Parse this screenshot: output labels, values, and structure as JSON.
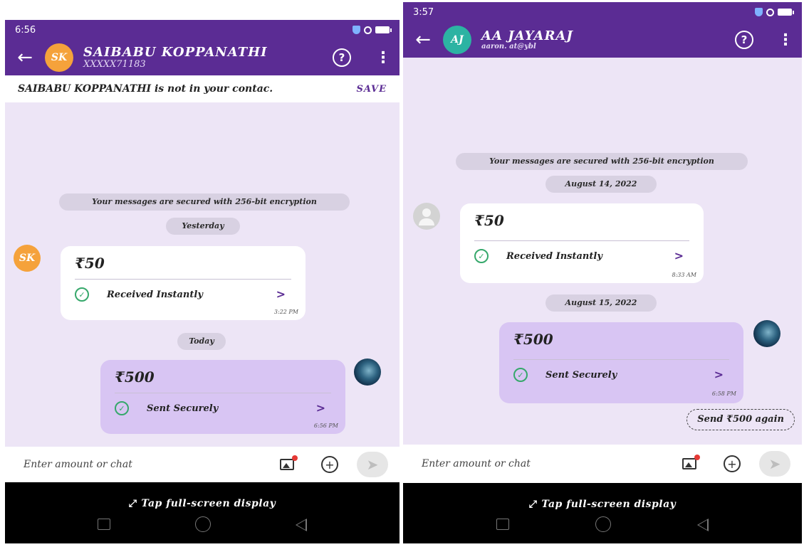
{
  "left": {
    "status_time": "6:56",
    "contact_name": "SAIBABU KOPPANATHI",
    "contact_sub": "XXXXX71183",
    "avatar_initials": "SK",
    "not_in_contacts": "SAIBABU KOPPANATHI is not in your contac.",
    "save_label": "SAVE",
    "encryption_note": "Your messages are secured with 256-bit encryption",
    "date_yesterday": "Yesterday",
    "date_today": "Today",
    "msg1": {
      "amount": "₹50",
      "status": "Received Instantly",
      "time": "3:22 PM"
    },
    "msg2": {
      "amount": "₹500",
      "status": "Sent Securely",
      "time": "6:56 PM"
    },
    "input_placeholder": "Enter amount or chat",
    "fullscreen_hint": "Tap full-screen display"
  },
  "right": {
    "status_time": "3:57",
    "contact_name": "AA JAYARAJ",
    "contact_sub": "aaron. at@ybl",
    "avatar_initials": "AJ",
    "encryption_note": "Your messages are secured with 256-bit encryption",
    "date1": "August 14, 2022",
    "date2": "August 15, 2022",
    "msg1": {
      "amount": "₹50",
      "status": "Received Instantly",
      "time": "8:33 AM"
    },
    "msg2": {
      "amount": "₹500",
      "status": "Sent Securely",
      "time": "6:58 PM"
    },
    "send_again": "Send ₹500 again",
    "input_placeholder": "Enter amount or chat",
    "fullscreen_hint": "Tap full-screen display"
  },
  "colors": {
    "primary": "#5b2c94",
    "chat_bg": "#ede5f6",
    "sent_bubble": "#d8c5f3",
    "success": "#36a86b"
  },
  "icons": [
    "back-arrow-icon",
    "help-icon",
    "more-icon",
    "check-circle-icon",
    "chevron-right-icon",
    "image-icon",
    "plus-icon",
    "send-icon",
    "fullscreen-icon"
  ]
}
